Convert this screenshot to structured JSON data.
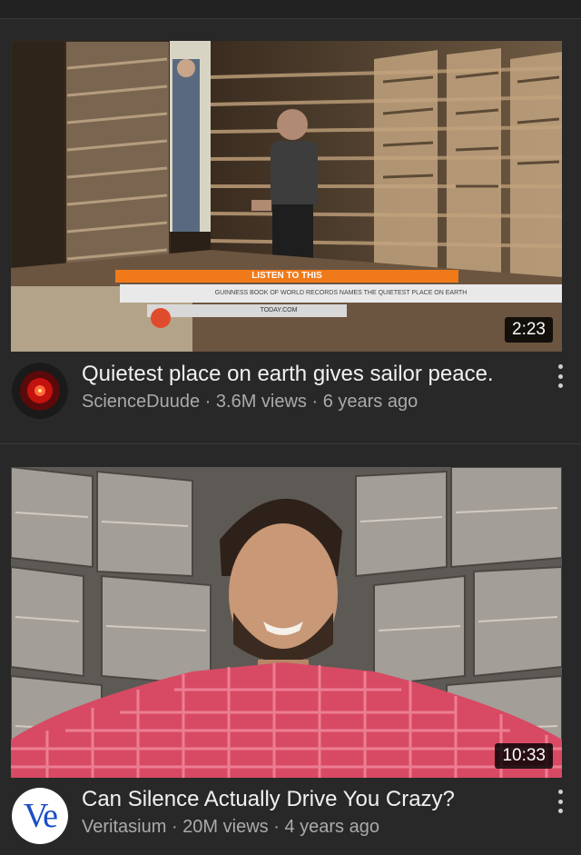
{
  "videos": [
    {
      "title": "Quietest place on earth gives sailor peace.",
      "channel": "ScienceDuude",
      "views": "3.6M views",
      "age": "6 years ago",
      "duration": "2:23",
      "avatar_icon": "hal-red-eye-icon",
      "thumbnail": {
        "banner_top": "LISTEN TO THIS",
        "banner_bottom": "GUINNESS BOOK OF WORLD RECORDS NAMES THE QUIETEST PLACE ON EARTH",
        "network": "TODAY.COM"
      }
    },
    {
      "title": "Can Silence Actually Drive You Crazy?",
      "channel": "Veritasium",
      "views": "20M views",
      "age": "4 years ago",
      "duration": "10:33",
      "avatar_text": "Ve"
    }
  ],
  "separator": "·",
  "colors": {
    "background": "#282828",
    "title_text": "#f1f1f1",
    "meta_text": "#aaaaaa",
    "banner_orange": "#f07a1a",
    "veritasium_blue": "#1a4fc4"
  }
}
